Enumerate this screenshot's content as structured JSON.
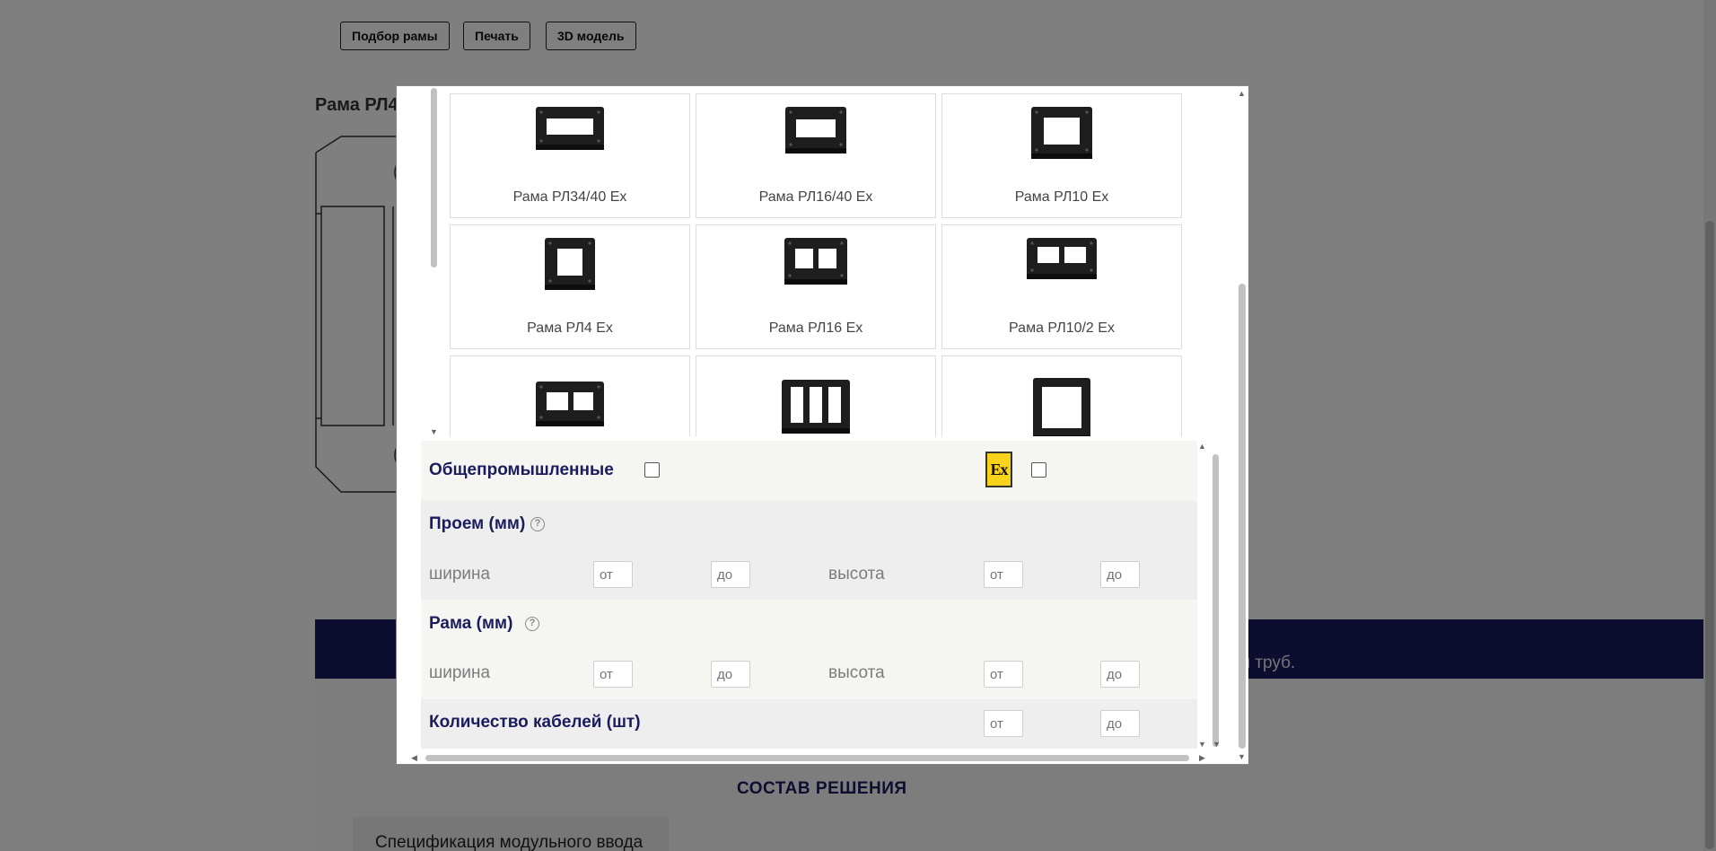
{
  "toolbar": {
    "buttons": [
      "Подбор рамы",
      "Печать",
      "3D модель"
    ]
  },
  "background": {
    "frame_title": "Рама РЛ4",
    "banner_text": "м труб.",
    "solution_title": "СОСТАВ РЕШЕНИЯ",
    "spec_label": "Спецификация модульного ввода"
  },
  "modal": {
    "cards": [
      {
        "label": "Рама РЛ34/40 Ex",
        "icon": "frame-wide-icon"
      },
      {
        "label": "Рама РЛ16/40 Ex",
        "icon": "frame-medium-icon"
      },
      {
        "label": "Рама РЛ10 Ex",
        "icon": "frame-square-icon"
      },
      {
        "label": "Рама РЛ4 Ex",
        "icon": "frame-small-square-icon"
      },
      {
        "label": "Рама РЛ16 Ex",
        "icon": "frame-double-icon"
      },
      {
        "label": "Рама РЛ10/2 Ex",
        "icon": "frame-double-wide-icon"
      },
      {
        "label": "",
        "icon": "frame-double-icon"
      },
      {
        "label": "",
        "icon": "frame-triple-icon"
      },
      {
        "label": "",
        "icon": "frame-large-square-icon"
      }
    ],
    "filters": {
      "general_label": "Общепромышленные",
      "ex_label": "Ex",
      "opening": {
        "title": "Проем (мм)",
        "width_label": "ширина",
        "height_label": "высота",
        "from_placeholder": "от",
        "to_placeholder": "до"
      },
      "frame": {
        "title": "Рама (мм)",
        "width_label": "ширина",
        "height_label": "высота",
        "from_placeholder": "от",
        "to_placeholder": "до"
      },
      "cables": {
        "title": "Количество кабелей (шт)",
        "from_placeholder": "от",
        "to_placeholder": "до"
      }
    }
  },
  "colors": {
    "accent": "#1b1c5e",
    "ex_badge": "#f8d21b",
    "overlay": "rgba(0,0,0,0.5)"
  }
}
